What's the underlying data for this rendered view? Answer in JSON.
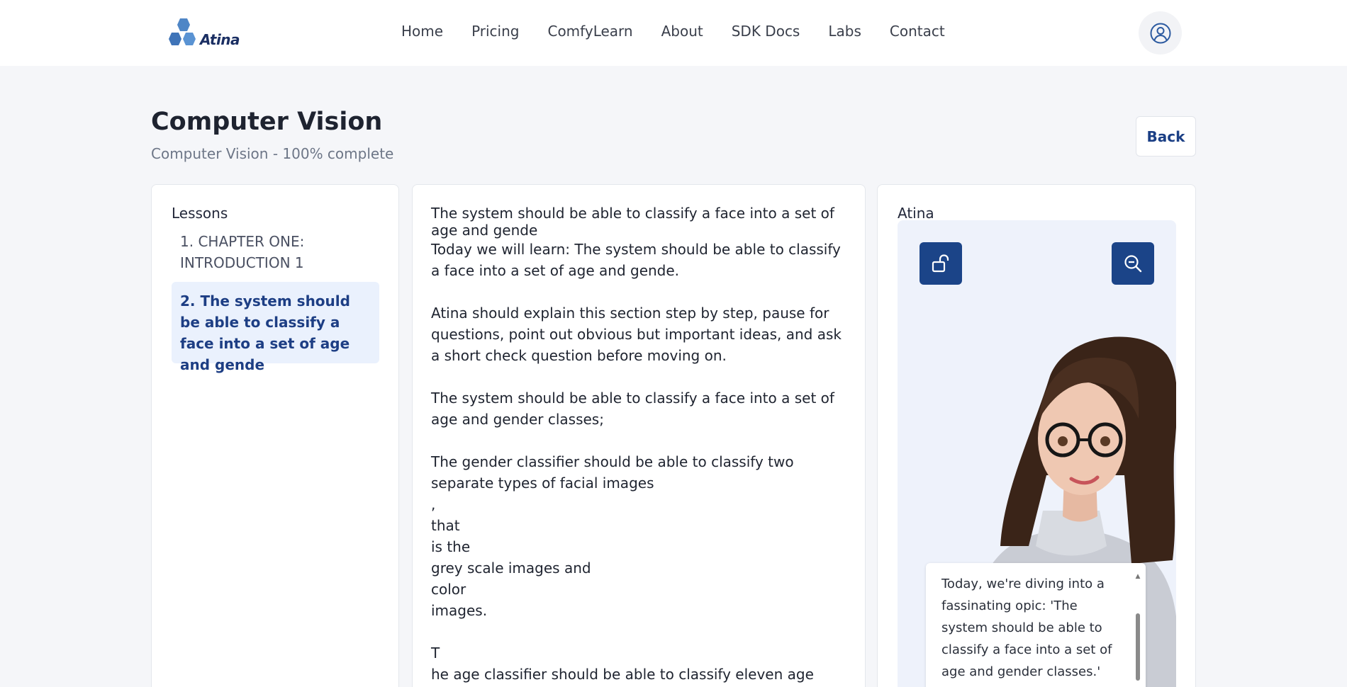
{
  "brand": {
    "name": "Atina"
  },
  "nav": {
    "items": [
      "Home",
      "Pricing",
      "ComfyLearn",
      "About",
      "SDK Docs",
      "Labs",
      "Contact"
    ]
  },
  "header": {
    "avatar_icon": "user-circle-icon"
  },
  "course": {
    "title": "Computer Vision",
    "subtitle": "Computer Vision - 100% complete",
    "back_label": "Back"
  },
  "lessons": {
    "label": "Lessons",
    "items": [
      {
        "label": "1. CHAPTER ONE: INTRODUCTION 1",
        "active": false
      },
      {
        "label": "2. The system should be able to classify a face into a set of age and gende",
        "active": true
      }
    ]
  },
  "content": {
    "heading": "The system should be able to classify a face into a set of age and gende",
    "body": "Today we will learn: The system should be able to classify a face into a set of age and gende.\n\nAtina should explain this section step by step, pause for questions, point out obvious but important ideas, and ask a short check question before moving on.\n\nThe system should be able to classify a face into a set of age and gender classes;\n\nThe gender classifier should be able to classify two separate types of facial images\n,\nthat\nis the\ngrey scale images and\ncolor\nimages.\n\nT\nhe age classifier should be able to classify eleven age groups"
  },
  "tutor": {
    "label": "Atina",
    "lock_icon": "unlock-icon",
    "zoom_icon": "zoom-out-icon",
    "speech": "Today, we're diving into a fassinating opic: 'The system should be able to classify a face into a set of age and gender classes.'"
  },
  "colors": {
    "accent": "#1b4488",
    "active_lesson_bg": "#eaf1fd",
    "page_bg": "#f5f6f9"
  }
}
